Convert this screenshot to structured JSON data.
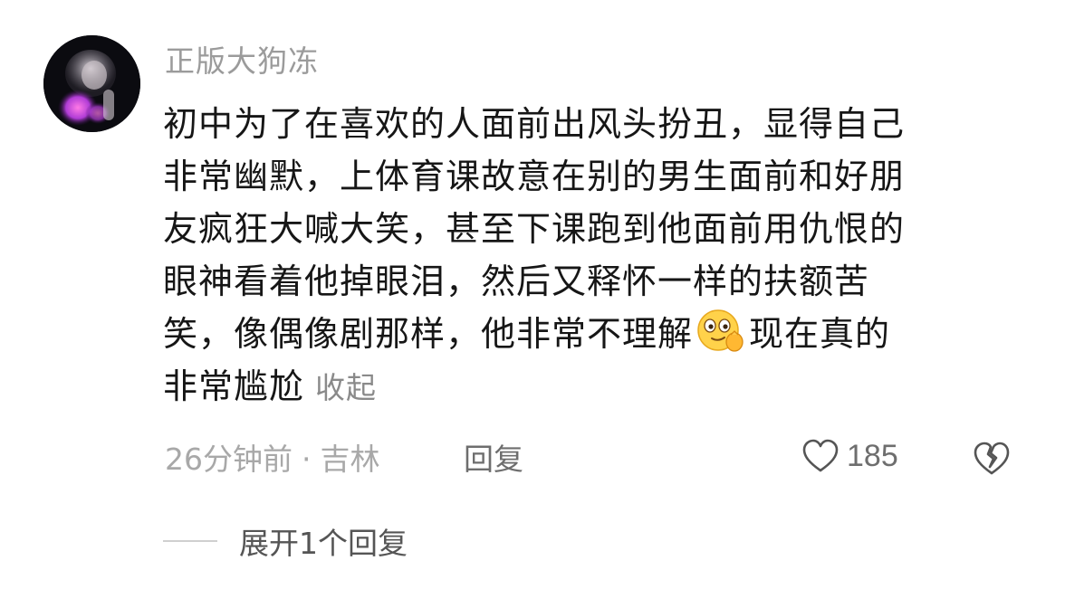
{
  "comment": {
    "username": "正版大狗冻",
    "body_lines": [
      "初中为了在喜欢的人面前出风头扮丑，显得自己",
      "非常幽默，上体育课故意在别的男生面前和好朋",
      "友疯狂大喊大笑，甚至下课跑到他面前用仇恨的",
      "眼神看着他掉眼泪，然后又释怀一样的扶额苦"
    ],
    "line5_before_emoji": "笑，像偶像剧那样，他非常不理解",
    "emoji_icon": "wink-pinch-emoji-icon",
    "line5_after_emoji": "现在真的",
    "line6": "非常尴尬",
    "collapse_label": "收起",
    "time": "26分钟前",
    "separator": "·",
    "location": "吉林",
    "reply_label": "回复",
    "like_count": "185",
    "like_icon": "heart-outline-icon",
    "dislike_icon": "broken-heart-icon",
    "expand_label": "展开1",
    "expand_label_partial": "个回复"
  }
}
